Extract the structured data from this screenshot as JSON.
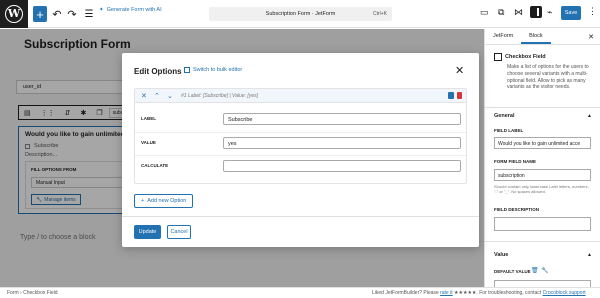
{
  "toolbar": {
    "generate_label": "Generate Form with AI",
    "document_title": "Subscription Form · JetForm",
    "shortcut": "Ctrl+K",
    "save_label": "Save"
  },
  "editor": {
    "form_title": "Subscription Form",
    "field_value": "user_id",
    "toolbar_variant": "subsc",
    "block": {
      "question": "Would you like to gain unlimited a",
      "checkbox_label": "Subscribe",
      "description": "Description...",
      "fill_options_label": "FILL OPTIONS FROM",
      "fill_options_value": "Manual Input",
      "manage_items_label": "Manage items"
    },
    "type_hint": "Type / to choose a block"
  },
  "sidebar": {
    "tabs": [
      "JetForm",
      "Block"
    ],
    "block_name": "Checkbox Field",
    "block_desc": "Make a list of options for the users to choose several variants with a multi-optional field. Allow to pick as many variants as the visitor needs.",
    "section_general": "General",
    "field_label_title": "FIELD LABEL",
    "field_label_value": "Would you like to gain unlimited acce",
    "form_field_name_title": "FORM FIELD NAME",
    "form_field_name_value": "subscription",
    "form_field_name_help": "Should contain only lowercase Latin letters, numbers, \"-\" or \"_\". No spaces allowed.",
    "field_description_title": "FIELD DESCRIPTION",
    "section_value": "Value",
    "default_value_title": "DEFAULT VALUE"
  },
  "statusbar": {
    "crumbs": [
      "Form",
      "Checkbox Field"
    ],
    "footer_prefix": "Liked JetFormBuilder? Please ",
    "footer_rate": "rate it",
    "footer_stars": " ★★★★★. For troubleshooting, contact ",
    "footer_link": "Crocoblock support"
  },
  "modal": {
    "title": "Edit Options",
    "bulk_label": "Switch to bulk editor",
    "option_summary": "#1 Label: [Subscribe] | Value: [yes]",
    "fields": [
      {
        "label": "LABEL",
        "value": "Subscribe"
      },
      {
        "label": "VALUE",
        "value": "yes"
      },
      {
        "label": "CALCULATE",
        "value": ""
      }
    ],
    "add_option_label": "Add new Option",
    "update_label": "Update",
    "cancel_label": "Cancel"
  }
}
